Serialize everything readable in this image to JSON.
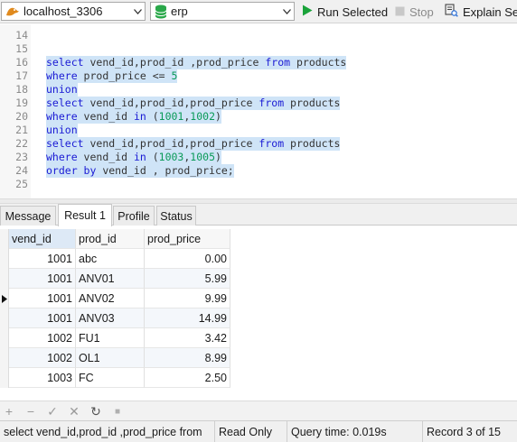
{
  "toolbar": {
    "connection": "localhost_3306",
    "database": "erp",
    "run_label": "Run Selected",
    "stop_label": "Stop",
    "explain_label": "Explain Se"
  },
  "editor": {
    "lines": [
      {
        "num": "14",
        "tokens": []
      },
      {
        "num": "15",
        "tokens": []
      },
      {
        "num": "16",
        "tokens": [
          {
            "t": "select",
            "c": "kw"
          },
          {
            "t": " vend_id,prod_id ,prod_price ",
            "c": "id"
          },
          {
            "t": "from",
            "c": "kw"
          },
          {
            "t": " products",
            "c": "id"
          }
        ]
      },
      {
        "num": "17",
        "tokens": [
          {
            "t": "where",
            "c": "kw"
          },
          {
            "t": " prod_price <= ",
            "c": "id"
          },
          {
            "t": "5",
            "c": "nm"
          }
        ]
      },
      {
        "num": "18",
        "tokens": [
          {
            "t": "union",
            "c": "kw"
          }
        ]
      },
      {
        "num": "19",
        "tokens": [
          {
            "t": "select",
            "c": "kw"
          },
          {
            "t": " vend_id,prod_id,prod_price ",
            "c": "id"
          },
          {
            "t": "from",
            "c": "kw"
          },
          {
            "t": " products",
            "c": "id"
          }
        ]
      },
      {
        "num": "20",
        "tokens": [
          {
            "t": "where",
            "c": "kw"
          },
          {
            "t": " vend_id ",
            "c": "id"
          },
          {
            "t": "in",
            "c": "kw"
          },
          {
            "t": " (",
            "c": "id"
          },
          {
            "t": "1001",
            "c": "nm"
          },
          {
            "t": ",",
            "c": "id"
          },
          {
            "t": "1002",
            "c": "nm"
          },
          {
            "t": ")",
            "c": "id"
          }
        ]
      },
      {
        "num": "21",
        "tokens": [
          {
            "t": "union",
            "c": "kw"
          }
        ]
      },
      {
        "num": "22",
        "tokens": [
          {
            "t": "select",
            "c": "kw"
          },
          {
            "t": " vend_id,prod_id,prod_price ",
            "c": "id"
          },
          {
            "t": "from",
            "c": "kw"
          },
          {
            "t": " products",
            "c": "id"
          }
        ]
      },
      {
        "num": "23",
        "tokens": [
          {
            "t": "where",
            "c": "kw"
          },
          {
            "t": " vend_id ",
            "c": "id"
          },
          {
            "t": "in",
            "c": "kw"
          },
          {
            "t": " (",
            "c": "id"
          },
          {
            "t": "1003",
            "c": "nm"
          },
          {
            "t": ",",
            "c": "id"
          },
          {
            "t": "1005",
            "c": "nm"
          },
          {
            "t": ")",
            "c": "id"
          }
        ]
      },
      {
        "num": "24",
        "tokens": [
          {
            "t": "order by",
            "c": "kw"
          },
          {
            "t": " vend_id , prod_price;",
            "c": "id"
          }
        ]
      },
      {
        "num": "25",
        "tokens": []
      }
    ]
  },
  "tabs": [
    {
      "label": "Message",
      "active": false
    },
    {
      "label": "Result 1",
      "active": true
    },
    {
      "label": "Profile",
      "active": false
    },
    {
      "label": "Status",
      "active": false
    }
  ],
  "grid": {
    "columns": [
      "vend_id",
      "prod_id",
      "prod_price"
    ],
    "rows": [
      [
        "1001",
        "abc",
        "0.00"
      ],
      [
        "1001",
        "ANV01",
        "5.99"
      ],
      [
        "1001",
        "ANV02",
        "9.99"
      ],
      [
        "1001",
        "ANV03",
        "14.99"
      ],
      [
        "1002",
        "FU1",
        "3.42"
      ],
      [
        "1002",
        "OL1",
        "8.99"
      ],
      [
        "1003",
        "FC",
        "2.50"
      ]
    ],
    "current_row": 3
  },
  "grid_tools": {
    "add": "+",
    "delete": "−",
    "apply": "✓",
    "discard": "✕",
    "refresh": "↻",
    "stop": "■"
  },
  "status": {
    "query": "select vend_id,prod_id ,prod_price from",
    "mode": "Read Only",
    "time": "Query time: 0.019s",
    "record": "Record 3 of 15"
  },
  "colors": {
    "keyword": "#1a1ad4",
    "number": "#0a9a58",
    "selection": "#cfe4f7",
    "run_green": "#1aa33a"
  }
}
